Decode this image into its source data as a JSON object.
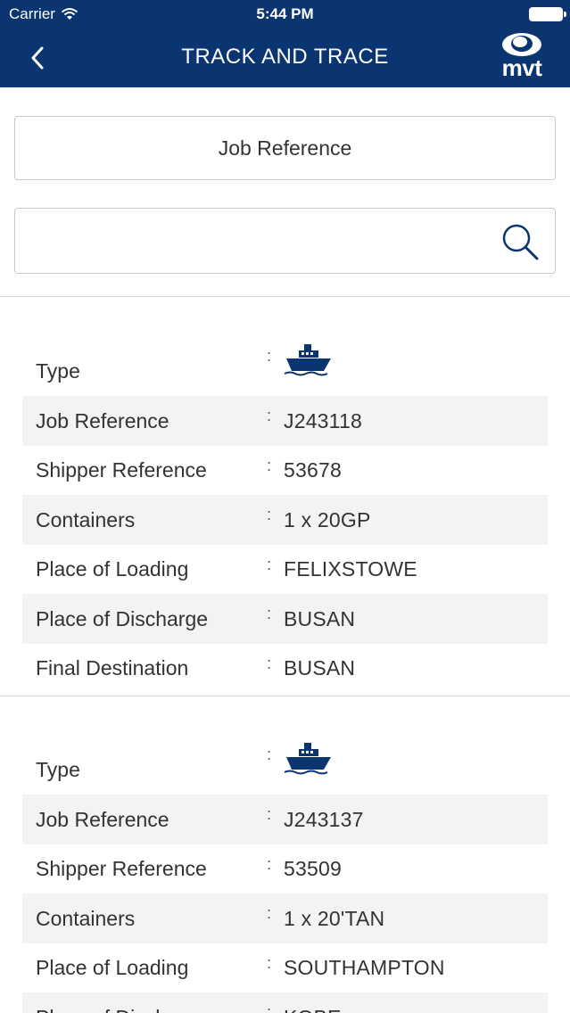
{
  "status_bar": {
    "carrier": "Carrier",
    "time": "5:44 PM"
  },
  "nav": {
    "title": "TRACK AND TRACE",
    "logo_text": "mvt"
  },
  "search_type": {
    "label": "Job Reference"
  },
  "search": {
    "value": "",
    "placeholder": ""
  },
  "colors": {
    "brand": "#0a3570",
    "row_shade": "#f3f3f4"
  },
  "jobs": [
    {
      "type_label": "Type",
      "type_icon": "ship-icon",
      "rows": [
        {
          "label": "Job Reference",
          "value": "J243118"
        },
        {
          "label": "Shipper Reference",
          "value": "53678"
        },
        {
          "label": "Containers",
          "value": "1 x 20GP"
        },
        {
          "label": "Place of Loading",
          "value": "FELIXSTOWE"
        },
        {
          "label": "Place of Discharge",
          "value": "BUSAN"
        },
        {
          "label": "Final Destination",
          "value": "BUSAN"
        }
      ]
    },
    {
      "type_label": "Type",
      "type_icon": "ship-icon",
      "rows": [
        {
          "label": "Job Reference",
          "value": "J243137"
        },
        {
          "label": "Shipper Reference",
          "value": "53509"
        },
        {
          "label": "Containers",
          "value": "1 x 20'TAN"
        },
        {
          "label": "Place of Loading",
          "value": "SOUTHAMPTON"
        },
        {
          "label": "Place of Discharge",
          "value": "KOBE"
        }
      ]
    }
  ]
}
